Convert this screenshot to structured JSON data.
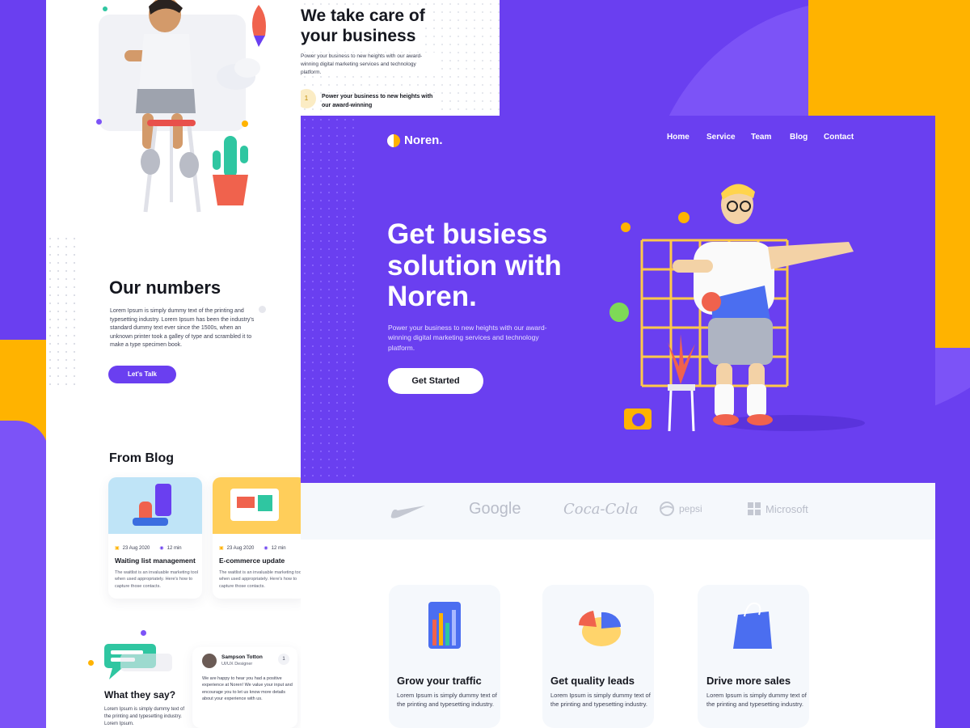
{
  "colors": {
    "purple": "#6a3ff0",
    "orange": "#ffb300",
    "light": "#f5f8fc",
    "dark": "#15171f"
  },
  "top_section": {
    "title_line1": "We take care of",
    "title_line2": "your business",
    "text": "Power your business to new heights with our award-winning digital marketing services and technology platform.",
    "step_number": "1",
    "step_text": "Power your business to new heights with our award-winning"
  },
  "numbers": {
    "title": "Our numbers",
    "text": "Lorem Ipsum is simply dummy text of the printing and typesetting industry. Lorem Ipsum has been the industry's standard dummy text ever since the 1500s, when an unknown printer took a galley of type and scrambled it to make a type specimen book.",
    "button": "Let's Talk"
  },
  "blog": {
    "title": "From Blog",
    "posts": [
      {
        "date": "23 Aug 2020",
        "read": "12 min",
        "title": "Waiting list management",
        "text": "The waitlist is an invaluable marketing tool when used appropriately. Here's how to capture those contacts."
      },
      {
        "date": "23 Aug 2020",
        "read": "12 min",
        "title": "E-commerce update",
        "text": "The waitlist is an invaluable marketing tool when used appropriately. Here's how to capture those contacts."
      }
    ]
  },
  "testimonial": {
    "title": "What they say?",
    "text": "Lorem Ipsum is simply dummy text of the printing and typesetting industry. Lorem Ipsum.",
    "name": "Sampson Totton",
    "role": "UI/UX Designer",
    "badge": "1",
    "quote": "We are happy to hear you had a positive experience at Noren! We value your input and encourage you to let us know more details about your experience with us."
  },
  "header": {
    "logo_text": "Noren.",
    "nav": [
      "Home",
      "Service",
      "Team",
      "Blog",
      "Contact"
    ]
  },
  "hero": {
    "title_line1": "Get busiess",
    "title_line2": "solution with",
    "title_line3": "Noren.",
    "text": "Power your business to new heights with our award-winning digital marketing services and technology platform.",
    "cta": "Get Started"
  },
  "logos": [
    "Google",
    "Coca-Cola",
    "pepsi",
    "Microsoft"
  ],
  "features": [
    {
      "title": "Grow your traffic",
      "text": "Lorem Ipsum is simply dummy text of the printing and typesetting industry.",
      "icon": "bar-chart-icon"
    },
    {
      "title": "Get quality leads",
      "text": "Lorem Ipsum is simply dummy text of the printing and typesetting industry.",
      "icon": "pie-chart-icon"
    },
    {
      "title": "Drive more sales",
      "text": "Lorem Ipsum is simply dummy text of the printing and typesetting industry.",
      "icon": "shopping-bag-icon"
    }
  ]
}
